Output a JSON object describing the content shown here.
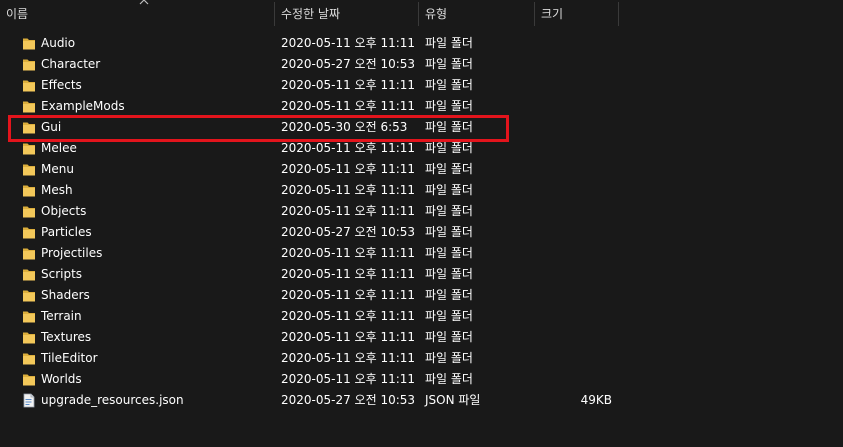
{
  "columns": {
    "name": "이름",
    "date": "수정한 날짜",
    "type": "유형",
    "size": "크기"
  },
  "colors": {
    "background": "#191919",
    "folder": "#f3c85a",
    "highlight": "#e3141c"
  },
  "files": [
    {
      "name": "Audio",
      "date": "2020-05-11 오후 11:11",
      "type": "파일 폴더",
      "size": "",
      "icon": "folder-icon"
    },
    {
      "name": "Character",
      "date": "2020-05-27 오전 10:53",
      "type": "파일 폴더",
      "size": "",
      "icon": "folder-icon"
    },
    {
      "name": "Effects",
      "date": "2020-05-11 오후 11:11",
      "type": "파일 폴더",
      "size": "",
      "icon": "folder-icon"
    },
    {
      "name": "ExampleMods",
      "date": "2020-05-11 오후 11:11",
      "type": "파일 폴더",
      "size": "",
      "icon": "folder-icon"
    },
    {
      "name": "Gui",
      "date": "2020-05-30 오전 6:53",
      "type": "파일 폴더",
      "size": "",
      "icon": "folder-icon"
    },
    {
      "name": "Melee",
      "date": "2020-05-11 오후 11:11",
      "type": "파일 폴더",
      "size": "",
      "icon": "folder-icon"
    },
    {
      "name": "Menu",
      "date": "2020-05-11 오후 11:11",
      "type": "파일 폴더",
      "size": "",
      "icon": "folder-icon"
    },
    {
      "name": "Mesh",
      "date": "2020-05-11 오후 11:11",
      "type": "파일 폴더",
      "size": "",
      "icon": "folder-icon"
    },
    {
      "name": "Objects",
      "date": "2020-05-11 오후 11:11",
      "type": "파일 폴더",
      "size": "",
      "icon": "folder-icon"
    },
    {
      "name": "Particles",
      "date": "2020-05-27 오전 10:53",
      "type": "파일 폴더",
      "size": "",
      "icon": "folder-icon"
    },
    {
      "name": "Projectiles",
      "date": "2020-05-11 오후 11:11",
      "type": "파일 폴더",
      "size": "",
      "icon": "folder-icon"
    },
    {
      "name": "Scripts",
      "date": "2020-05-11 오후 11:11",
      "type": "파일 폴더",
      "size": "",
      "icon": "folder-icon"
    },
    {
      "name": "Shaders",
      "date": "2020-05-11 오후 11:11",
      "type": "파일 폴더",
      "size": "",
      "icon": "folder-icon"
    },
    {
      "name": "Terrain",
      "date": "2020-05-11 오후 11:11",
      "type": "파일 폴더",
      "size": "",
      "icon": "folder-icon"
    },
    {
      "name": "Textures",
      "date": "2020-05-11 오후 11:11",
      "type": "파일 폴더",
      "size": "",
      "icon": "folder-icon"
    },
    {
      "name": "TileEditor",
      "date": "2020-05-11 오후 11:11",
      "type": "파일 폴더",
      "size": "",
      "icon": "folder-icon"
    },
    {
      "name": "Worlds",
      "date": "2020-05-11 오후 11:11",
      "type": "파일 폴더",
      "size": "",
      "icon": "folder-icon"
    },
    {
      "name": "upgrade_resources.json",
      "date": "2020-05-27 오전 10:53",
      "type": "JSON 파일",
      "size": "49KB",
      "icon": "json-file-icon"
    }
  ]
}
